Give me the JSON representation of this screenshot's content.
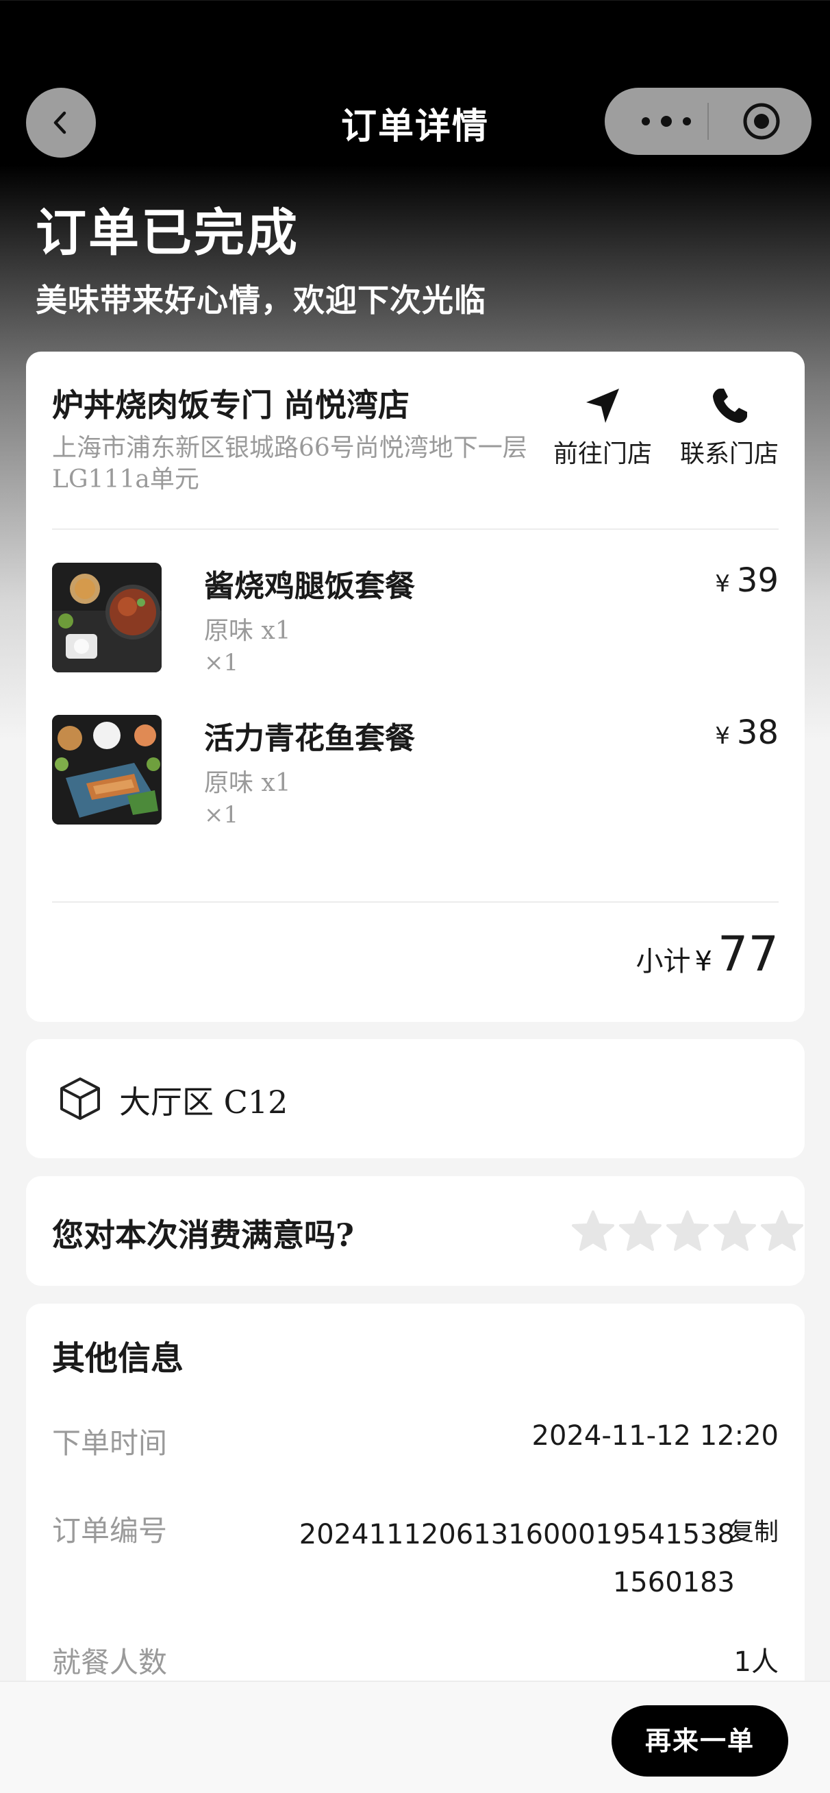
{
  "nav": {
    "title": "订单详情"
  },
  "status": {
    "title": "订单已完成",
    "subtitle": "美味带来好心情，欢迎下次光临"
  },
  "store": {
    "name": "炉丼烧肉饭专门 尚悦湾店",
    "address": "上海市浦东新区银城路66号尚悦湾地下一层LG111a单元",
    "actions": {
      "navigate_label": "前往门店",
      "call_label": "联系门店"
    }
  },
  "items": [
    {
      "name": "酱烧鸡腿饭套餐",
      "spec": "原味 x1",
      "qty": "×1",
      "currency": "¥",
      "price": "39"
    },
    {
      "name": "活力青花鱼套餐",
      "spec": "原味 x1",
      "qty": "×1",
      "currency": "¥",
      "price": "38"
    }
  ],
  "subtotal": {
    "label": "小计",
    "currency": "¥",
    "amount": "77"
  },
  "table": {
    "text": "大厅区 C12"
  },
  "rating": {
    "question": "您对本次消费满意吗?",
    "max_stars": 5,
    "selected": 0
  },
  "info": {
    "title": "其他信息",
    "order_time": {
      "label": "下单时间",
      "value": "2024-11-12 12:20"
    },
    "order_no": {
      "label": "订单编号",
      "value": "20241112061316000195415381560183",
      "copy_label": "复制"
    },
    "diners": {
      "label": "就餐人数",
      "value": "1人"
    }
  },
  "bottom": {
    "reorder_label": "再来一单"
  },
  "colors": {
    "accent": "#000000",
    "muted_text": "#9a9a9a",
    "star_empty": "#e6e6e6"
  }
}
